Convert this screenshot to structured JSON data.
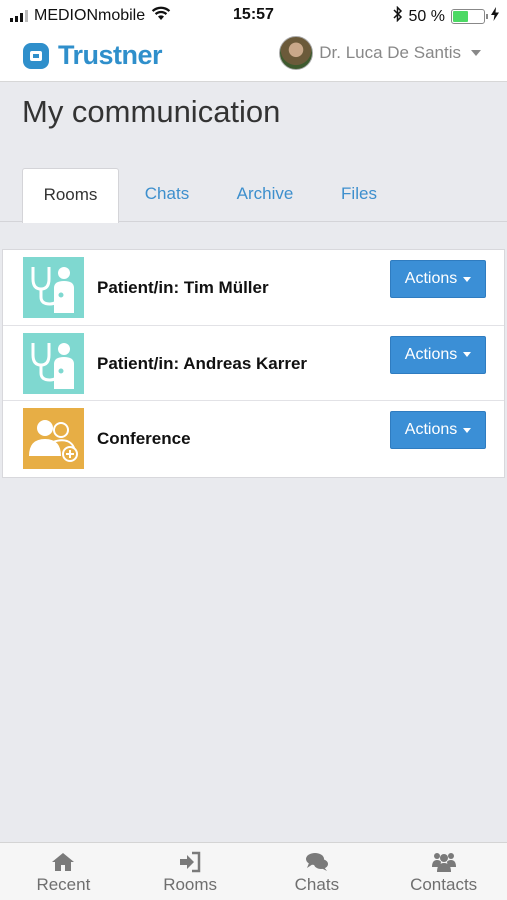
{
  "status_bar": {
    "carrier": "MEDIONmobile",
    "time": "15:57",
    "battery": "50 %",
    "battery_level": 0.5,
    "icons": [
      "signal-icon",
      "wifi-icon",
      "bluetooth-icon",
      "battery-icon",
      "charging-icon"
    ]
  },
  "header": {
    "brand": "Trustner",
    "user_name": "Dr. Luca De Santis",
    "brand_color": "#2f8fcb"
  },
  "page": {
    "title": "My communication"
  },
  "tabs": [
    {
      "label": "Rooms",
      "active": true
    },
    {
      "label": "Chats",
      "active": false
    },
    {
      "label": "Archive",
      "active": false
    },
    {
      "label": "Files",
      "active": false
    }
  ],
  "rooms": [
    {
      "name": "Patient/in: Tim Müller",
      "icon": "doctor-icon",
      "icon_color": "#7fd8d0",
      "actions_label": "Actions"
    },
    {
      "name": "Patient/in: Andreas Karrer",
      "icon": "doctor-icon",
      "icon_color": "#7fd8d0",
      "actions_label": "Actions"
    },
    {
      "name": "Conference",
      "icon": "group-add-icon",
      "icon_color": "#e7ae45",
      "actions_label": "Actions"
    }
  ],
  "bottom_nav": [
    {
      "label": "Recent",
      "icon": "home-icon"
    },
    {
      "label": "Rooms",
      "icon": "sign-in-icon"
    },
    {
      "label": "Chats",
      "icon": "comments-icon"
    },
    {
      "label": "Contacts",
      "icon": "users-icon"
    }
  ],
  "colors": {
    "accent": "#3b8fd6",
    "background": "#e9eaee"
  }
}
